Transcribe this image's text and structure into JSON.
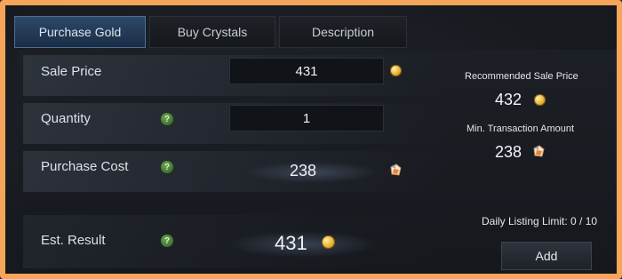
{
  "tabs": [
    {
      "label": "Purchase Gold",
      "active": true
    },
    {
      "label": "Buy Crystals",
      "active": false
    },
    {
      "label": "Description",
      "active": false
    }
  ],
  "form": {
    "sale_price": {
      "label": "Sale Price",
      "value": "431",
      "currency": "gold-coin-icon"
    },
    "quantity": {
      "label": "Quantity",
      "value": "1",
      "help": "?"
    },
    "purchase_cost": {
      "label": "Purchase Cost",
      "value": "238",
      "currency": "crystal-icon",
      "help": "?"
    },
    "est_result": {
      "label": "Est. Result",
      "value": "431",
      "currency": "gold-coin-icon",
      "help": "?"
    }
  },
  "side": {
    "recommended_title": "Recommended Sale Price",
    "recommended_value": "432",
    "min_title": "Min. Transaction Amount",
    "min_value": "238",
    "daily_limit": "Daily Listing Limit: 0 / 10",
    "add_label": "Add"
  },
  "colors": {
    "frame": "#f5a45a",
    "active_tab": "#2c4868",
    "help": "#6aa84f",
    "gold": "#e3a92b"
  }
}
